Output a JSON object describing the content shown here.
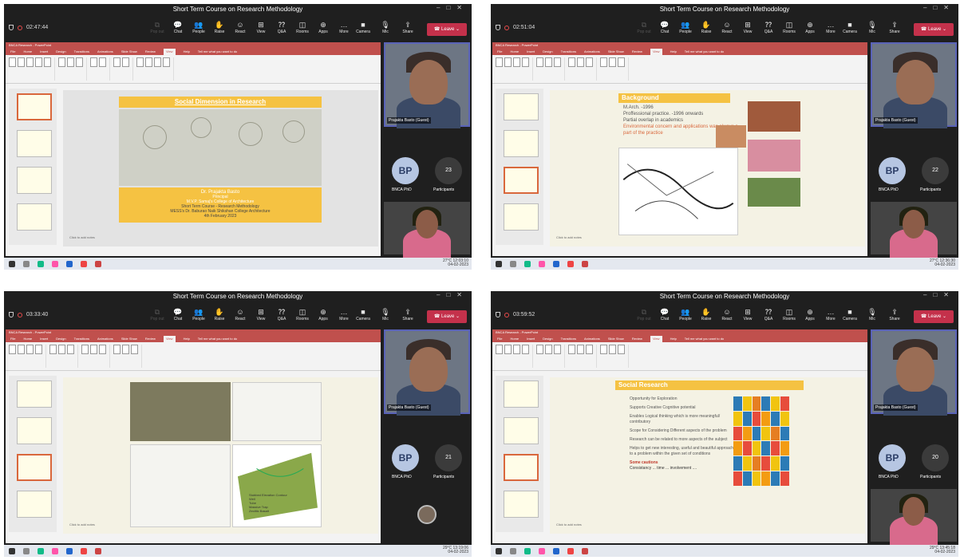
{
  "meeting_title": "Short Term Course on Research Methodology",
  "toolbar": {
    "items": [
      "Chat",
      "People",
      "Raise",
      "React",
      "View",
      "Q&A",
      "Rooms",
      "Apps",
      "More"
    ],
    "disabled_item": "Pop out",
    "camera": "Camera",
    "mic": "Mic",
    "share": "Share",
    "leave": "Leave"
  },
  "presenter_name": "Prajakta Basto (Guest)",
  "avatar_initials": "BP",
  "avatar_label": "BNCA PhD",
  "participants_label": "Participants",
  "ppt": {
    "window_title": "BNCA Research - PowerPoint",
    "tabs": [
      "File",
      "Home",
      "Insert",
      "Design",
      "Transitions",
      "Animations",
      "Slide Show",
      "Review",
      "View",
      "Help"
    ],
    "active_tab": "View",
    "tell_me": "Tell me what you want to do",
    "notes_hint": "Click to add notes"
  },
  "panels": [
    {
      "timer": "02:47:44",
      "participants": "23",
      "clock": "12:03:10",
      "date": "04-02-2023",
      "temp": "27°C",
      "slide": {
        "title": "Social Dimension in Research",
        "presenter": "Dr. Prajakta Basto",
        "role": "Principal",
        "college": "M.V.P. Samaj's College of Architecture",
        "course": "Short Term Course - Research Methodology",
        "venue": "MESS's Dr. Baburao Naik Shikshan College Architecture",
        "date": "4th February 2023"
      }
    },
    {
      "timer": "02:51:04",
      "participants": "22",
      "clock": "12:36:30",
      "date": "04-02-2023",
      "temp": "27°C",
      "slide": {
        "title": "Background",
        "bullets": [
          "M.Arch. -1996",
          "Proffessional practice. -1996 onwards",
          "Partial overlap in academics"
        ],
        "highlight": "Environmental concern and applications was always a part of the practice"
      }
    },
    {
      "timer": "03:33:40",
      "participants": "21",
      "clock": "13:19:06",
      "date": "04-02-2023",
      "temp": "29°C",
      "slide": {
        "legend": [
          "Stubbed Elevation Contour",
          "Well",
          "Tube",
          "Massive Trap",
          "Zeolitic Basalt"
        ]
      }
    },
    {
      "timer": "03:59:52",
      "participants": "20",
      "clock": "13:45:18",
      "date": "04-02-2023",
      "temp": "29°C",
      "slide": {
        "title": "Social Research",
        "bullets": [
          "Opportunity for Exploration",
          "Supports Creative Cognitive potential",
          "Enables Logical thinking which is more meaningful/ contributory",
          "Scope for Considering Different aspects of the problem",
          "Research can be related to more aspects of the subject",
          "Helps to get new interesting, useful and beautiful approaches to a problem within the given set of conditions"
        ],
        "caution_title": "Some cautions",
        "caution_text": "Consistancy ... time ... involvement ...."
      }
    }
  ],
  "colors": {
    "accent": "#f5c242",
    "leave": "#c4314b",
    "ppt": "#c0504d",
    "avatar": "#b6c6e2"
  }
}
